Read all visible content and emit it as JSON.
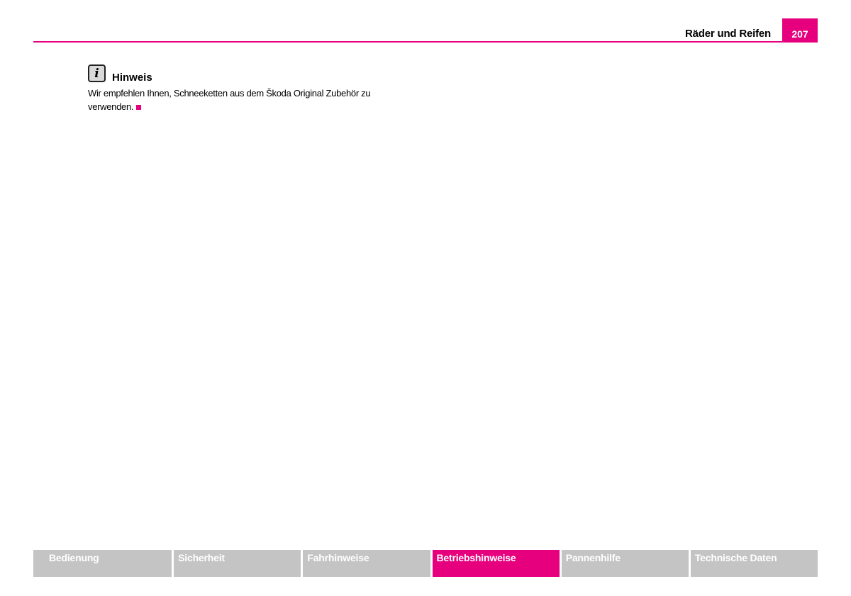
{
  "header": {
    "section_title": "Räder und Reifen",
    "page_number": "207"
  },
  "note": {
    "icon": "info-icon",
    "title": "Hinweis",
    "text": "Wir empfehlen Ihnen, Schneeketten aus dem Škoda Original Zubehör zu verwenden."
  },
  "footer_nav": {
    "tabs": [
      {
        "label": "Bedienung",
        "active": false
      },
      {
        "label": "Sicherheit",
        "active": false
      },
      {
        "label": "Fahrhinweise",
        "active": false
      },
      {
        "label": "Betriebshinweise",
        "active": true
      },
      {
        "label": "Pannenhilfe",
        "active": false
      },
      {
        "label": "Technische Daten",
        "active": false
      }
    ]
  },
  "colors": {
    "accent": "#e6007e",
    "tab_inactive": "#c4c4c4",
    "text": "#000000"
  }
}
